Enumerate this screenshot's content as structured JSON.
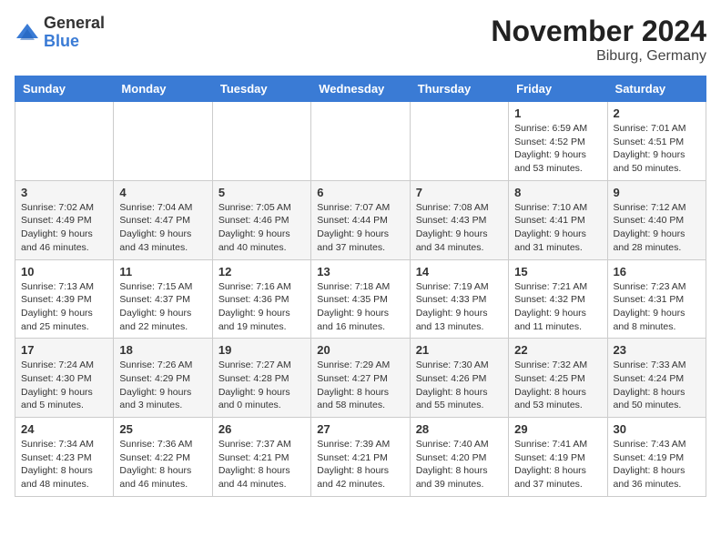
{
  "logo": {
    "general": "General",
    "blue": "Blue"
  },
  "title": "November 2024",
  "location": "Biburg, Germany",
  "days_of_week": [
    "Sunday",
    "Monday",
    "Tuesday",
    "Wednesday",
    "Thursday",
    "Friday",
    "Saturday"
  ],
  "weeks": [
    [
      {
        "day": "",
        "info": ""
      },
      {
        "day": "",
        "info": ""
      },
      {
        "day": "",
        "info": ""
      },
      {
        "day": "",
        "info": ""
      },
      {
        "day": "",
        "info": ""
      },
      {
        "day": "1",
        "info": "Sunrise: 6:59 AM\nSunset: 4:52 PM\nDaylight: 9 hours and 53 minutes."
      },
      {
        "day": "2",
        "info": "Sunrise: 7:01 AM\nSunset: 4:51 PM\nDaylight: 9 hours and 50 minutes."
      }
    ],
    [
      {
        "day": "3",
        "info": "Sunrise: 7:02 AM\nSunset: 4:49 PM\nDaylight: 9 hours and 46 minutes."
      },
      {
        "day": "4",
        "info": "Sunrise: 7:04 AM\nSunset: 4:47 PM\nDaylight: 9 hours and 43 minutes."
      },
      {
        "day": "5",
        "info": "Sunrise: 7:05 AM\nSunset: 4:46 PM\nDaylight: 9 hours and 40 minutes."
      },
      {
        "day": "6",
        "info": "Sunrise: 7:07 AM\nSunset: 4:44 PM\nDaylight: 9 hours and 37 minutes."
      },
      {
        "day": "7",
        "info": "Sunrise: 7:08 AM\nSunset: 4:43 PM\nDaylight: 9 hours and 34 minutes."
      },
      {
        "day": "8",
        "info": "Sunrise: 7:10 AM\nSunset: 4:41 PM\nDaylight: 9 hours and 31 minutes."
      },
      {
        "day": "9",
        "info": "Sunrise: 7:12 AM\nSunset: 4:40 PM\nDaylight: 9 hours and 28 minutes."
      }
    ],
    [
      {
        "day": "10",
        "info": "Sunrise: 7:13 AM\nSunset: 4:39 PM\nDaylight: 9 hours and 25 minutes."
      },
      {
        "day": "11",
        "info": "Sunrise: 7:15 AM\nSunset: 4:37 PM\nDaylight: 9 hours and 22 minutes."
      },
      {
        "day": "12",
        "info": "Sunrise: 7:16 AM\nSunset: 4:36 PM\nDaylight: 9 hours and 19 minutes."
      },
      {
        "day": "13",
        "info": "Sunrise: 7:18 AM\nSunset: 4:35 PM\nDaylight: 9 hours and 16 minutes."
      },
      {
        "day": "14",
        "info": "Sunrise: 7:19 AM\nSunset: 4:33 PM\nDaylight: 9 hours and 13 minutes."
      },
      {
        "day": "15",
        "info": "Sunrise: 7:21 AM\nSunset: 4:32 PM\nDaylight: 9 hours and 11 minutes."
      },
      {
        "day": "16",
        "info": "Sunrise: 7:23 AM\nSunset: 4:31 PM\nDaylight: 9 hours and 8 minutes."
      }
    ],
    [
      {
        "day": "17",
        "info": "Sunrise: 7:24 AM\nSunset: 4:30 PM\nDaylight: 9 hours and 5 minutes."
      },
      {
        "day": "18",
        "info": "Sunrise: 7:26 AM\nSunset: 4:29 PM\nDaylight: 9 hours and 3 minutes."
      },
      {
        "day": "19",
        "info": "Sunrise: 7:27 AM\nSunset: 4:28 PM\nDaylight: 9 hours and 0 minutes."
      },
      {
        "day": "20",
        "info": "Sunrise: 7:29 AM\nSunset: 4:27 PM\nDaylight: 8 hours and 58 minutes."
      },
      {
        "day": "21",
        "info": "Sunrise: 7:30 AM\nSunset: 4:26 PM\nDaylight: 8 hours and 55 minutes."
      },
      {
        "day": "22",
        "info": "Sunrise: 7:32 AM\nSunset: 4:25 PM\nDaylight: 8 hours and 53 minutes."
      },
      {
        "day": "23",
        "info": "Sunrise: 7:33 AM\nSunset: 4:24 PM\nDaylight: 8 hours and 50 minutes."
      }
    ],
    [
      {
        "day": "24",
        "info": "Sunrise: 7:34 AM\nSunset: 4:23 PM\nDaylight: 8 hours and 48 minutes."
      },
      {
        "day": "25",
        "info": "Sunrise: 7:36 AM\nSunset: 4:22 PM\nDaylight: 8 hours and 46 minutes."
      },
      {
        "day": "26",
        "info": "Sunrise: 7:37 AM\nSunset: 4:21 PM\nDaylight: 8 hours and 44 minutes."
      },
      {
        "day": "27",
        "info": "Sunrise: 7:39 AM\nSunset: 4:21 PM\nDaylight: 8 hours and 42 minutes."
      },
      {
        "day": "28",
        "info": "Sunrise: 7:40 AM\nSunset: 4:20 PM\nDaylight: 8 hours and 39 minutes."
      },
      {
        "day": "29",
        "info": "Sunrise: 7:41 AM\nSunset: 4:19 PM\nDaylight: 8 hours and 37 minutes."
      },
      {
        "day": "30",
        "info": "Sunrise: 7:43 AM\nSunset: 4:19 PM\nDaylight: 8 hours and 36 minutes."
      }
    ]
  ]
}
